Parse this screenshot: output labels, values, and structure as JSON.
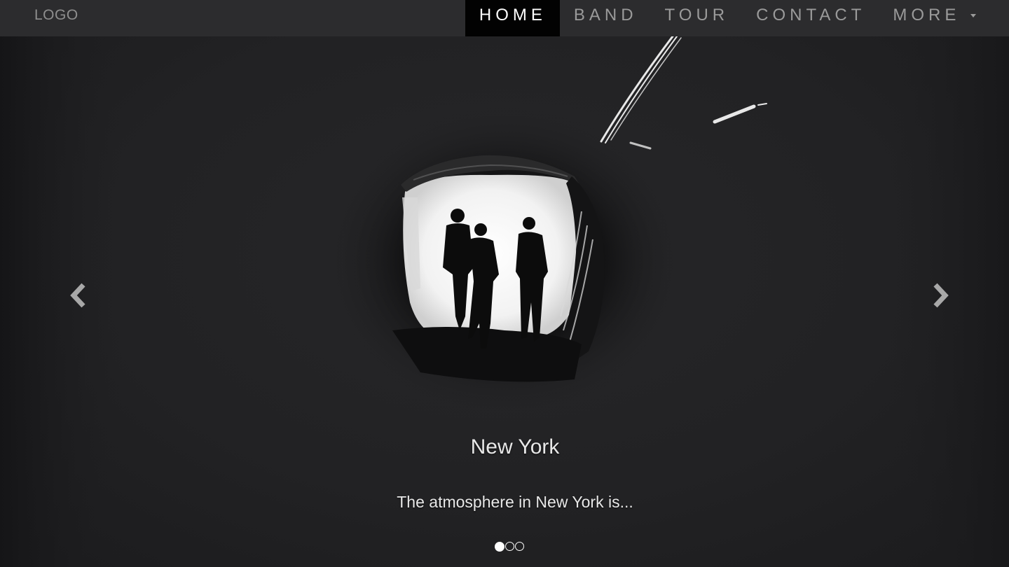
{
  "navbar": {
    "logo": "LOGO",
    "items": [
      {
        "label": "HOME",
        "active": true
      },
      {
        "label": "BAND",
        "active": false
      },
      {
        "label": "TOUR",
        "active": false
      },
      {
        "label": "CONTACT",
        "active": false
      },
      {
        "label": "MORE",
        "active": false,
        "dropdown": true
      }
    ]
  },
  "carousel": {
    "caption_title": "New York",
    "caption_text": "The atmosphere in New York is...",
    "slide_count": 3,
    "active_slide": 1,
    "prev_icon": "chevron-left-icon",
    "next_icon": "chevron-right-icon"
  },
  "colors": {
    "navbar_bg": "#2c2c2e",
    "active_nav_bg": "#020202",
    "page_bg": "#222224"
  }
}
